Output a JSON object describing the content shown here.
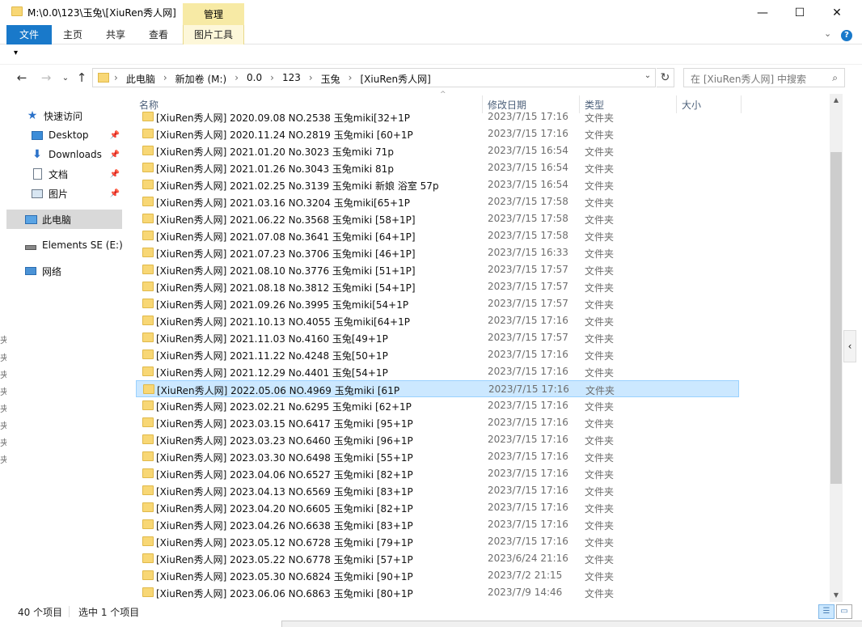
{
  "window": {
    "title": "M:\\0.0\\123\\玉兔\\[XiuRen秀人网]",
    "context_tab_header": "管理",
    "minimize_glyph": "—",
    "maximize_glyph": "☐",
    "close_glyph": "✕"
  },
  "ribbon": {
    "file": "文件",
    "home": "主页",
    "share": "共享",
    "view": "查看",
    "picture_tools": "图片工具",
    "expand_glyph": "⌄",
    "help_glyph": "?"
  },
  "qat": {
    "dropdown_glyph": "▾"
  },
  "nav": {
    "back_glyph": "←",
    "forward_glyph": "→",
    "recent_glyph": "⌄",
    "up_glyph": "↑",
    "breadcrumbs": [
      "此电脑",
      "新加卷 (M:)",
      "0.0",
      "123",
      "玉兔",
      "[XiuRen秀人网]"
    ],
    "crumb_sep": "›",
    "address_drop_glyph": "⌄",
    "refresh_glyph": "↻",
    "search_placeholder": "在 [XiuRen秀人网] 中搜索",
    "search_glyph": "⌕"
  },
  "navpane": {
    "quick_access": "快速访问",
    "desktop": "Desktop",
    "downloads": "Downloads",
    "documents": "文档",
    "pictures": "图片",
    "this_pc": "此电脑",
    "elements": "Elements SE (E:)",
    "network": "网络",
    "pin_glyph": "📌",
    "star_glyph": "★",
    "down_glyph": "⬇",
    "edge_char": "夹"
  },
  "columns": {
    "name": "名称",
    "date": "修改日期",
    "type": "类型",
    "size": "大小",
    "sort_glyph": "^"
  },
  "files": [
    {
      "name": "[XiuRen秀人网] 2020.09.08 NO.2538 玉兔miki[32+1P",
      "date": "2023/7/15 17:16",
      "type": "文件夹"
    },
    {
      "name": "[XiuRen秀人网] 2020.11.24 NO.2819 玉兔miki [60+1P",
      "date": "2023/7/15 17:16",
      "type": "文件夹"
    },
    {
      "name": "[XiuRen秀人网] 2021.01.20 No.3023 玉兔miki 71p",
      "date": "2023/7/15 16:54",
      "type": "文件夹"
    },
    {
      "name": "[XiuRen秀人网] 2021.01.26 No.3043 玉兔miki 81p",
      "date": "2023/7/15 16:54",
      "type": "文件夹"
    },
    {
      "name": "[XiuRen秀人网] 2021.02.25 No.3139 玉兔miki 新娘 浴室 57p",
      "date": "2023/7/15 16:54",
      "type": "文件夹"
    },
    {
      "name": "[XiuRen秀人网] 2021.03.16 NO.3204 玉兔miki[65+1P",
      "date": "2023/7/15 17:58",
      "type": "文件夹"
    },
    {
      "name": "[XiuRen秀人网] 2021.06.22 No.3568 玉兔miki [58+1P]",
      "date": "2023/7/15 17:58",
      "type": "文件夹"
    },
    {
      "name": "[XiuRen秀人网] 2021.07.08 No.3641 玉兔miki [64+1P]",
      "date": "2023/7/15 17:58",
      "type": "文件夹"
    },
    {
      "name": "[XiuRen秀人网] 2021.07.23 No.3706 玉兔miki [46+1P]",
      "date": "2023/7/15 16:33",
      "type": "文件夹"
    },
    {
      "name": "[XiuRen秀人网] 2021.08.10 No.3776 玉兔miki [51+1P]",
      "date": "2023/7/15 17:57",
      "type": "文件夹"
    },
    {
      "name": "[XiuRen秀人网] 2021.08.18 No.3812 玉兔miki [54+1P]",
      "date": "2023/7/15 17:57",
      "type": "文件夹"
    },
    {
      "name": "[XiuRen秀人网] 2021.09.26 No.3995 玉兔miki[54+1P",
      "date": "2023/7/15 17:57",
      "type": "文件夹"
    },
    {
      "name": "[XiuRen秀人网] 2021.10.13 NO.4055 玉兔miki[64+1P",
      "date": "2023/7/15 17:16",
      "type": "文件夹"
    },
    {
      "name": "[XiuRen秀人网] 2021.11.03 No.4160 玉兔[49+1P",
      "date": "2023/7/15 17:57",
      "type": "文件夹"
    },
    {
      "name": "[XiuRen秀人网] 2021.11.22 No.4248 玉兔[50+1P",
      "date": "2023/7/15 17:16",
      "type": "文件夹"
    },
    {
      "name": "[XiuRen秀人网] 2021.12.29 No.4401 玉兔[54+1P",
      "date": "2023/7/15 17:16",
      "type": "文件夹"
    },
    {
      "name": "[XiuRen秀人网] 2022.05.06 NO.4969 玉兔miki [61P",
      "date": "2023/7/15 17:16",
      "type": "文件夹",
      "selected": true
    },
    {
      "name": "[XiuRen秀人网] 2023.02.21 No.6295 玉兔miki [62+1P",
      "date": "2023/7/15 17:16",
      "type": "文件夹"
    },
    {
      "name": "[XiuRen秀人网] 2023.03.15 NO.6417 玉兔miki [95+1P",
      "date": "2023/7/15 17:16",
      "type": "文件夹"
    },
    {
      "name": "[XiuRen秀人网] 2023.03.23 NO.6460 玉兔miki [96+1P",
      "date": "2023/7/15 17:16",
      "type": "文件夹"
    },
    {
      "name": "[XiuRen秀人网] 2023.03.30 NO.6498 玉兔miki [55+1P",
      "date": "2023/7/15 17:16",
      "type": "文件夹"
    },
    {
      "name": "[XiuRen秀人网] 2023.04.06 NO.6527 玉兔miki [82+1P",
      "date": "2023/7/15 17:16",
      "type": "文件夹"
    },
    {
      "name": "[XiuRen秀人网] 2023.04.13 NO.6569 玉兔miki [83+1P",
      "date": "2023/7/15 17:16",
      "type": "文件夹"
    },
    {
      "name": "[XiuRen秀人网] 2023.04.20 NO.6605 玉兔miki [82+1P",
      "date": "2023/7/15 17:16",
      "type": "文件夹"
    },
    {
      "name": "[XiuRen秀人网] 2023.04.26 NO.6638 玉兔miki [83+1P",
      "date": "2023/7/15 17:16",
      "type": "文件夹"
    },
    {
      "name": "[XiuRen秀人网] 2023.05.12 NO.6728 玉兔miki [79+1P",
      "date": "2023/7/15 17:16",
      "type": "文件夹"
    },
    {
      "name": "[XiuRen秀人网] 2023.05.22 NO.6778 玉兔miki [57+1P",
      "date": "2023/6/24 21:16",
      "type": "文件夹"
    },
    {
      "name": "[XiuRen秀人网] 2023.05.30 NO.6824 玉兔miki [90+1P",
      "date": "2023/7/2 21:15",
      "type": "文件夹"
    },
    {
      "name": "[XiuRen秀人网] 2023.06.06 NO.6863 玉兔miki [80+1P",
      "date": "2023/7/9 14:46",
      "type": "文件夹"
    }
  ],
  "scroll": {
    "up_glyph": "▲",
    "down_glyph": "▼",
    "thumb_position_fraction": 0.3
  },
  "side_arrow_glyph": "‹",
  "status": {
    "item_count": "40 个项目",
    "selected": "选中 1 个项目",
    "details_view_glyph": "☰",
    "tiles_view_glyph": "▭"
  },
  "colors": {
    "accent": "#1979ca",
    "selection": "#cce8ff",
    "folder": "#f8d775",
    "context_tab": "#f7eaa5"
  }
}
